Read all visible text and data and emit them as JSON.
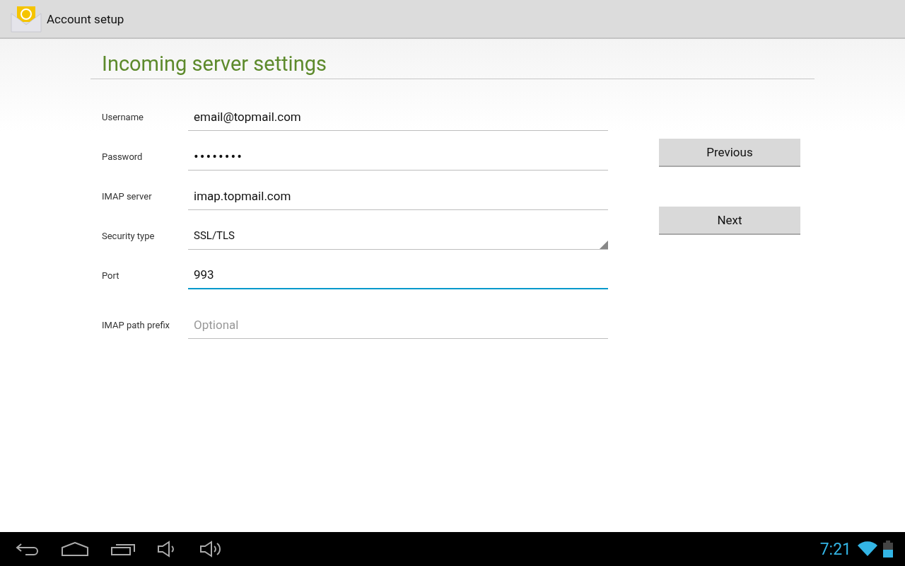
{
  "action_bar": {
    "title": "Account setup"
  },
  "heading": "Incoming server settings",
  "fields": [
    {
      "label": "Username",
      "kind": "text",
      "value": "email@topmail.com",
      "focused": false
    },
    {
      "label": "Password",
      "kind": "password",
      "value": "••••••••",
      "focused": false
    },
    {
      "label": "IMAP server",
      "kind": "text",
      "value": "imap.topmail.com",
      "focused": false
    },
    {
      "label": "Security type",
      "kind": "dropdown",
      "value": "SSL/TLS",
      "focused": false
    },
    {
      "label": "Port",
      "kind": "text",
      "value": "993",
      "focused": true
    },
    {
      "label": "IMAP path prefix",
      "kind": "text",
      "placeholder": "Optional",
      "focused": false
    }
  ],
  "buttons": [
    "Previous",
    "Next"
  ],
  "status_bar": {
    "time": "7:21"
  }
}
